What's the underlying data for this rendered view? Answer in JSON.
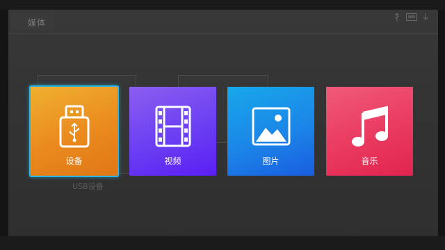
{
  "header": {
    "title": "媒体"
  },
  "background": {
    "ghost_caption": "USB设备"
  },
  "tiles": [
    {
      "id": "device",
      "label": "设备",
      "icon": "usb-drive-icon",
      "color": "#ea8a1e",
      "selected": true
    },
    {
      "id": "video",
      "label": "视频",
      "icon": "film-strip-icon",
      "color": "#6a3ff2",
      "selected": false
    },
    {
      "id": "photo",
      "label": "图片",
      "icon": "image-icon",
      "color": "#1b86e8",
      "selected": false
    },
    {
      "id": "music",
      "label": "音乐",
      "icon": "music-note-icon",
      "color": "#ea3a60",
      "selected": false
    }
  ],
  "status_bar": {
    "icons": [
      "usb-status-icon",
      "card-status-icon",
      "download-status-icon"
    ]
  }
}
